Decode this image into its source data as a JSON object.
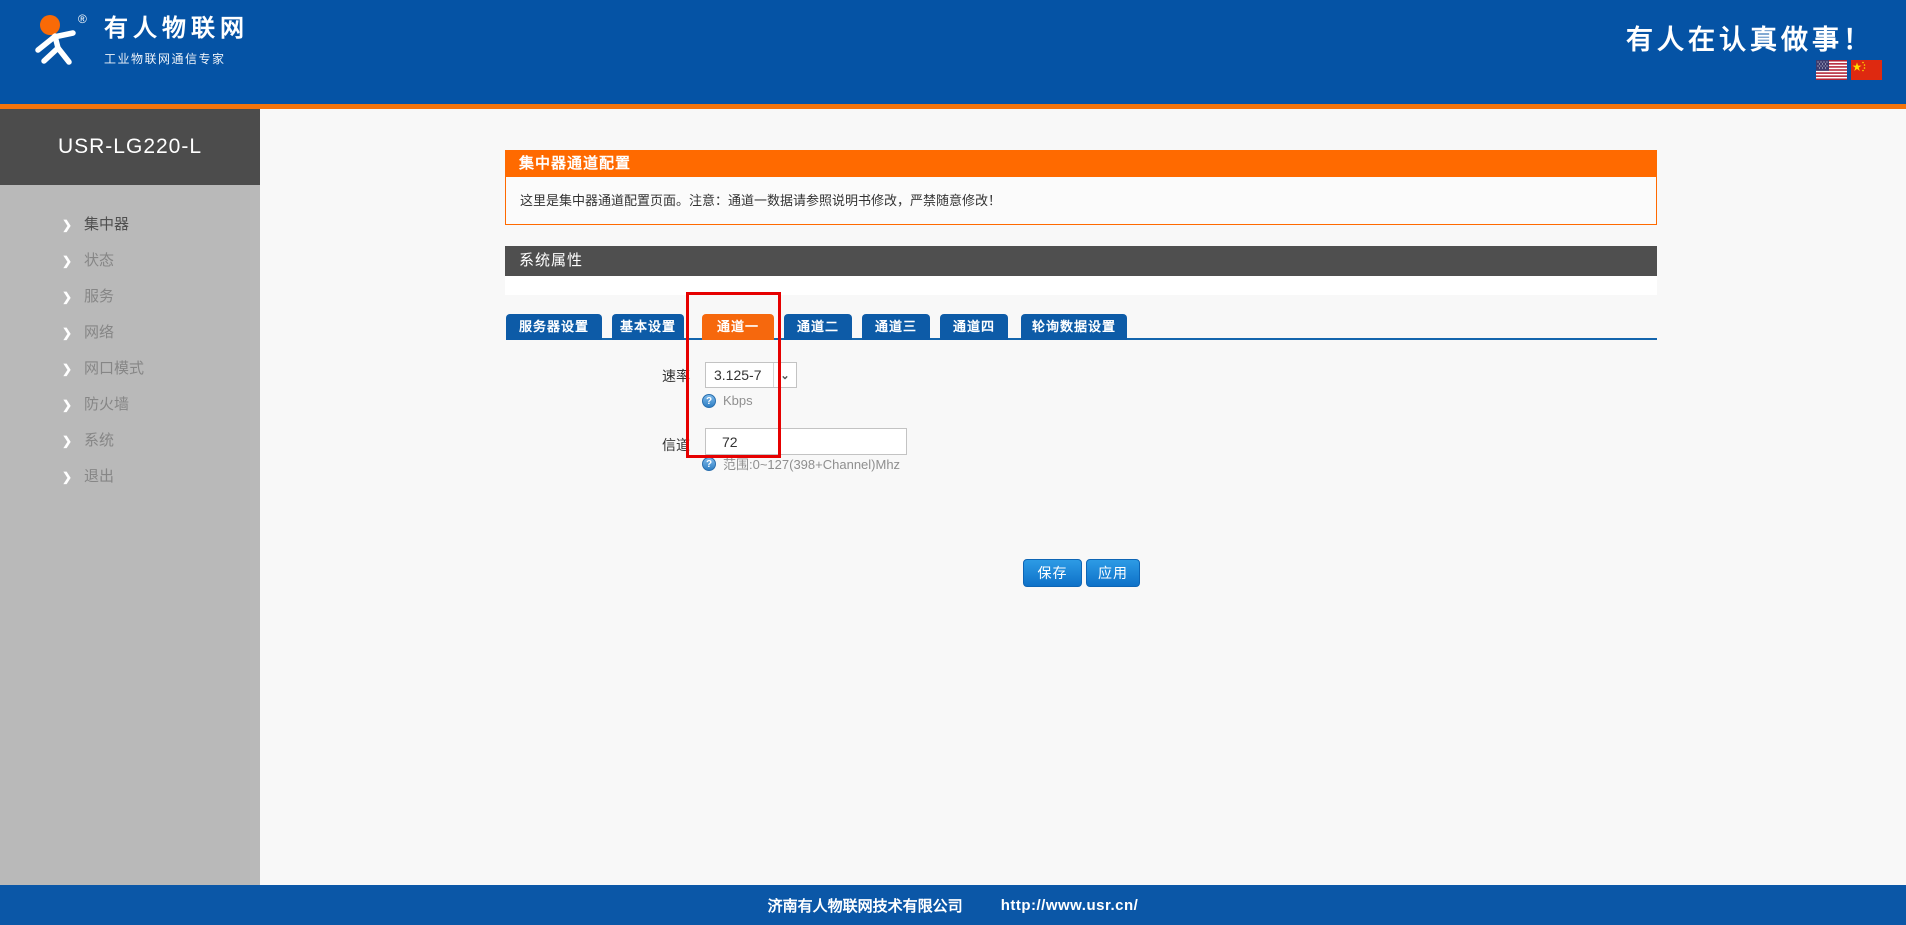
{
  "header": {
    "brand": {
      "title": "有人物联网",
      "subtitle": "工业物联网通信专家",
      "reg": "®"
    },
    "slogan": "有人在认真做事！"
  },
  "sidebar": {
    "device": "USR-LG220-L",
    "items": [
      {
        "label": "集中器"
      },
      {
        "label": "状态"
      },
      {
        "label": "服务"
      },
      {
        "label": "网络"
      },
      {
        "label": "网口模式"
      },
      {
        "label": "防火墙"
      },
      {
        "label": "系统"
      },
      {
        "label": "退出"
      }
    ],
    "chevron": "❯"
  },
  "main": {
    "panel_title": "集中器通道配置",
    "panel_note": "这里是集中器通道配置页面。注意：通道一数据请参照说明书修改，严禁随意修改！",
    "section_title": "系统属性",
    "tabs": [
      {
        "label": "服务器设置",
        "active": false
      },
      {
        "label": "基本设置",
        "active": false
      },
      {
        "label": "通道一",
        "active": true
      },
      {
        "label": "通道二",
        "active": false
      },
      {
        "label": "通道三",
        "active": false
      },
      {
        "label": "通道四",
        "active": false
      },
      {
        "label": "轮询数据设置",
        "active": false
      }
    ],
    "form": {
      "rate": {
        "label": "速率",
        "value": "3.125-7",
        "hint": "Kbps"
      },
      "channel": {
        "label": "信道",
        "value": "72",
        "hint": "范围:0~127(398+Channel)Mhz"
      },
      "help_glyph": "?"
    },
    "buttons": {
      "save": "保存",
      "apply": "应用"
    }
  },
  "footer": {
    "company": "济南有人物联网技术有限公司",
    "url": "http://www.usr.cn/"
  },
  "colors": {
    "header_blue": "#0553a5",
    "accent_orange": "#ff6a00",
    "tab_blue": "#0d5ba7",
    "active_tab_orange": "#f6680d",
    "annotation_red": "#e60000",
    "footer_blue": "#0b57a7"
  }
}
